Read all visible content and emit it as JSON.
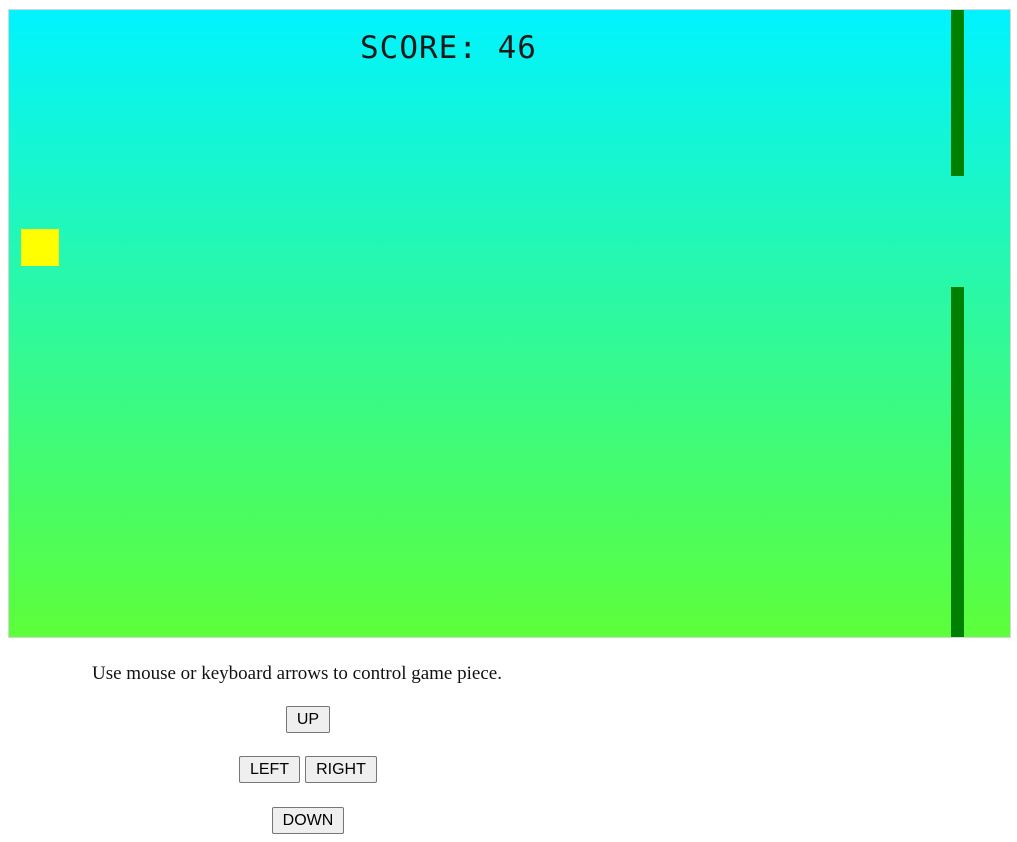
{
  "game": {
    "score_text": "SCORE: 46",
    "colors": {
      "sky_top": "#00f3ff",
      "sky_bottom": "#5dff3a",
      "player": "#ffff00",
      "obstacle": "#008000"
    }
  },
  "instructions": "Use mouse or keyboard arrows to control game piece.",
  "controls": {
    "up": "UP",
    "left": "LEFT",
    "right": "RIGHT",
    "down": "DOWN"
  }
}
